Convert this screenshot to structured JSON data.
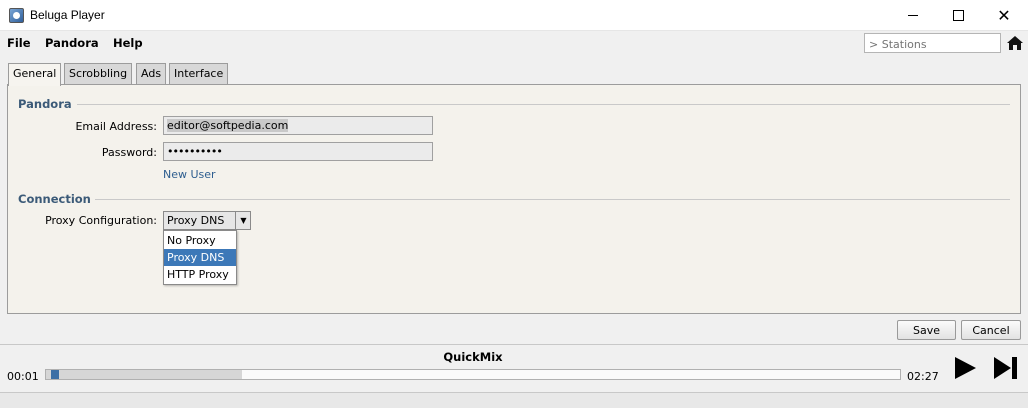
{
  "window": {
    "title": "Beluga Player"
  },
  "menu": {
    "file": "File",
    "pandora": "Pandora",
    "help": "Help"
  },
  "stations": {
    "placeholder": "> Stations"
  },
  "tabs": {
    "general": "General",
    "scrobbling": "Scrobbling",
    "ads": "Ads",
    "interface": "Interface"
  },
  "pandora_section": {
    "title": "Pandora",
    "email_label": "Email Address:",
    "email_value": "editor@softpedia.com",
    "password_label": "Password:",
    "password_value": "••••••••••",
    "new_user_link": "New User"
  },
  "connection_section": {
    "title": "Connection",
    "proxy_label": "Proxy Configuration:",
    "proxy_value": "Proxy DNS",
    "proxy_options": [
      "No Proxy",
      "Proxy DNS",
      "HTTP Proxy"
    ],
    "selected_index": 1
  },
  "buttons": {
    "save": "Save",
    "cancel": "Cancel"
  },
  "player": {
    "now_playing": "QuickMix",
    "elapsed": "00:01",
    "total": "02:27",
    "progress_fraction": 0.01,
    "buffer_fraction": 0.23
  },
  "colors": {
    "accent": "#3c78b8",
    "section_title": "#3b5a78",
    "link": "#2e5e8f"
  },
  "icons": {
    "home": "home-icon",
    "play": "play-icon",
    "next": "next-track-icon"
  }
}
